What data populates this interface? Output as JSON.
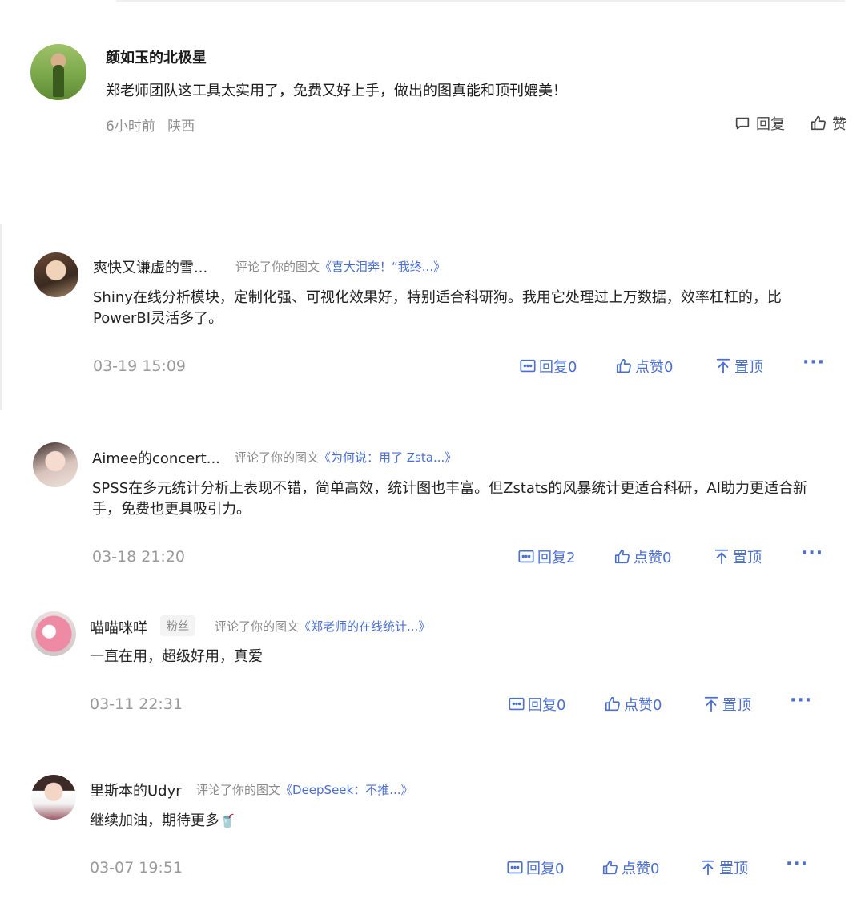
{
  "first_comment": {
    "name": "颜如玉的北极星",
    "text": "郑老师团队这工具太实用了，免费又好上手，做出的图真能和顶刊媲美！",
    "time": "6小时前",
    "location": "陕西",
    "reply_label": "回复",
    "like_label": "赞"
  },
  "comments": [
    {
      "name": "爽快又谦虚的雪...",
      "action": "评论了你的图文",
      "post_title": "《喜大泪奔！“我终...》",
      "text": "Shiny在线分析模块，定制化强、可视化效果好，特别适合科研狗。我用它处理过上万数据，效率杠杠的，比PowerBI灵活多了。",
      "date": "03-19 15:09",
      "reply": "回复0",
      "like": "点赞0",
      "pin": "置顶",
      "more": "···"
    },
    {
      "name": "Aimee的concert...",
      "action": "评论了你的图文",
      "post_title": "《为何说：用了 Zsta...》",
      "text": "SPSS在多元统计分析上表现不错，简单高效，统计图也丰富。但Zstats的风暴统计更适合科研，AI助力更适合新手，免费也更具吸引力。",
      "date": "03-18 21:20",
      "reply": "回复2",
      "like": "点赞0",
      "pin": "置顶",
      "more": "···"
    },
    {
      "name": "喵喵咪咩",
      "badge": "粉丝",
      "action": "评论了你的图文",
      "post_title": "《郑老师的在线统计...》",
      "text": "一直在用，超级好用，真爱",
      "date": "03-11 22:31",
      "reply": "回复0",
      "like": "点赞0",
      "pin": "置顶",
      "more": "···"
    },
    {
      "name": "里斯本的Udyr",
      "action": "评论了你的图文",
      "post_title": "《DeepSeek：不推...》",
      "text": "继续加油，期待更多",
      "emoji": "🥤",
      "date": "03-07 19:51",
      "reply": "回复0",
      "like": "点赞0",
      "pin": "置顶",
      "more": "···"
    }
  ],
  "colors": {
    "link": "#4a6fd1",
    "meta": "#9a9a9a",
    "text": "#222222"
  },
  "icons": [
    "comment-icon",
    "thumbs-up-icon",
    "reply-box-icon",
    "pin-top-icon",
    "more-icon"
  ]
}
